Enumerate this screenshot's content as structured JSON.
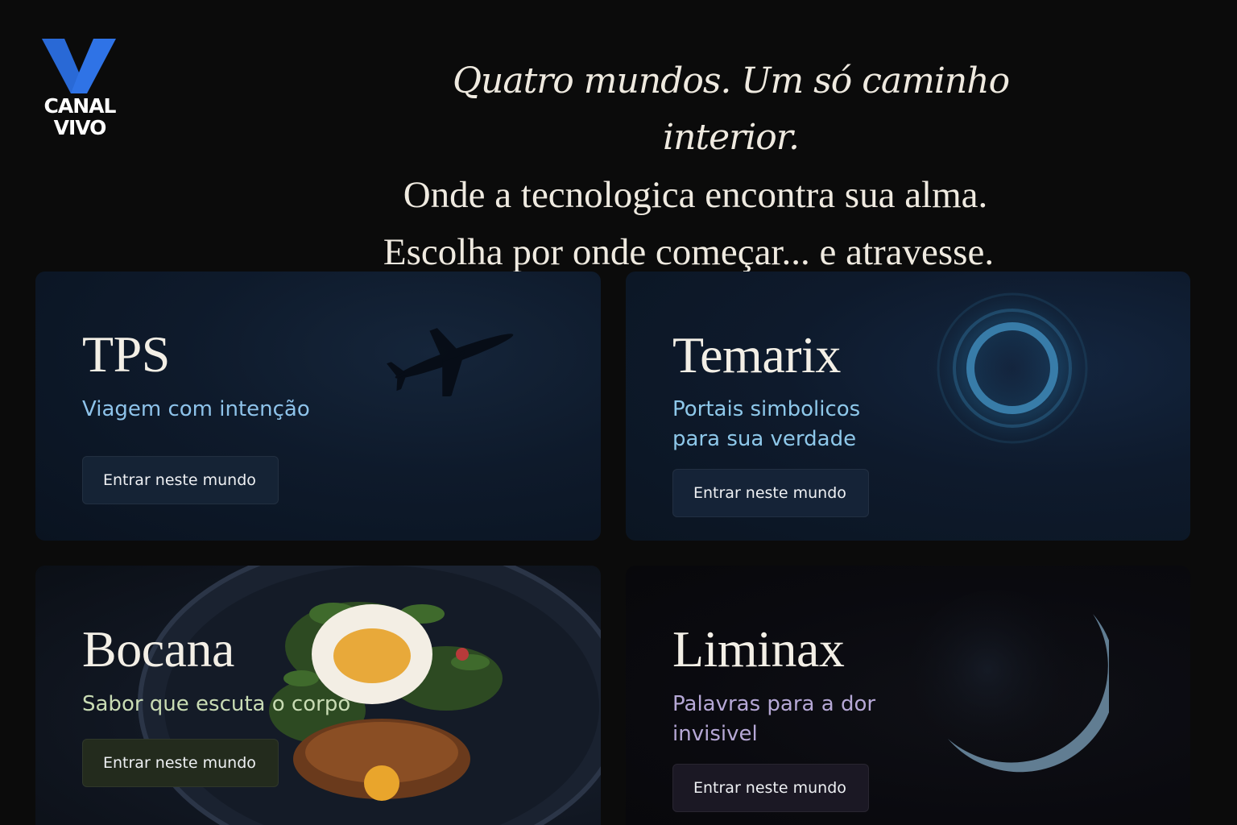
{
  "brand": {
    "logo_line1": "CANAL",
    "logo_line2": "VIVO",
    "accent": "#2f73e6"
  },
  "hero": {
    "line1": "Quatro mundos. Um só caminho interior.",
    "line2": "Onde a tecnologica encontra sua alma.",
    "line3": "Escolha por onde começar... e atravesse."
  },
  "worlds": [
    {
      "title": "TPS",
      "subtitle": "Viagem com intenção",
      "subtitle_color": "#8ec3ea",
      "button": "Entrar neste mundo",
      "icon": "airplane-icon"
    },
    {
      "title": "Temarix",
      "subtitle_line1": "Portais simbolicos",
      "subtitle_line2": "para sua verdade",
      "subtitle_color": "#8ec8ea",
      "button": "Entrar neste mundo",
      "icon": "portal-ring-icon"
    },
    {
      "title": "Bocana",
      "subtitle": "Sabor que escuta o corpo",
      "subtitle_color": "#c9dcb4",
      "button": "Entrar neste mundo",
      "icon": "poached-egg-dish-image"
    },
    {
      "title": "Liminax",
      "subtitle_line1": "Palavras para a dor",
      "subtitle_line2": "invisivel",
      "subtitle_color": "#b6a8d6",
      "button": "Entrar neste mundo",
      "icon": "crescent-moon-icon"
    }
  ]
}
